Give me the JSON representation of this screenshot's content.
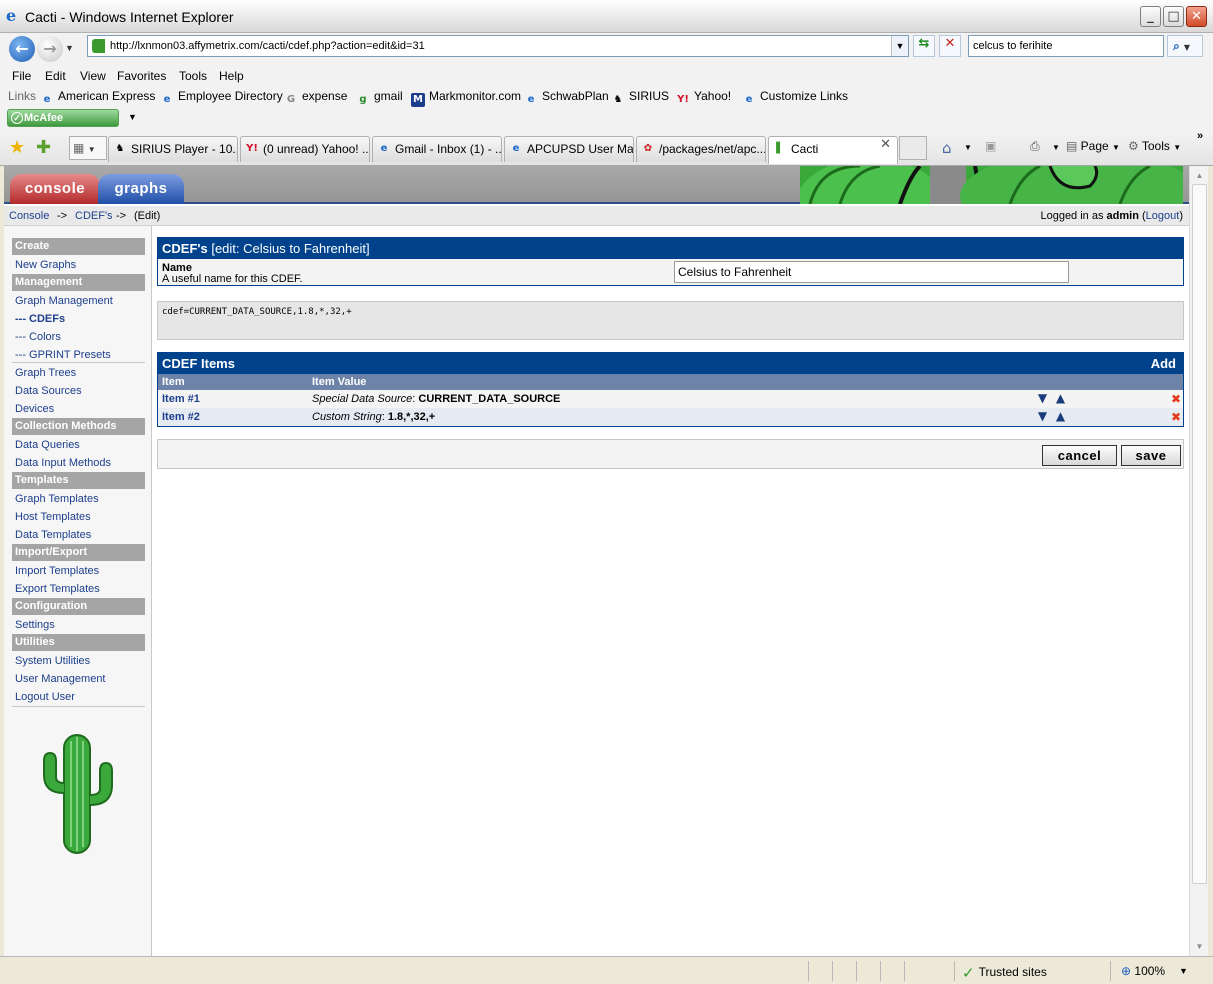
{
  "window": {
    "title": "Cacti - Windows Internet Explorer"
  },
  "address": {
    "url": "http://lxnmon03.affymetrix.com/cacti/cdef.php?action=edit&id=31"
  },
  "search": {
    "value": "celcus to ferihite"
  },
  "menu": [
    "File",
    "Edit",
    "View",
    "Favorites",
    "Tools",
    "Help"
  ],
  "links": {
    "label": "Links",
    "items": [
      "American Express",
      "Employee Directory",
      "expense",
      "gmail",
      "Markmonitor.com",
      "SchwabPlan",
      "SIRIUS",
      "Yahoo!",
      "Customize Links"
    ]
  },
  "mcafee": {
    "label": "McAfee SiteAdvisor"
  },
  "tabs": [
    {
      "label": "SIRIUS Player - 10...",
      "icon": "sirius-dog-icon"
    },
    {
      "label": "(0 unread) Yahoo! ...",
      "icon": "yahoo-icon"
    },
    {
      "label": "Gmail - Inbox (1) - ...",
      "icon": "ie-page-icon"
    },
    {
      "label": "APCUPSD User Ma...",
      "icon": "ie-logo-icon"
    },
    {
      "label": "/packages/net/apc...",
      "icon": "bsd-paw-icon"
    },
    {
      "label": "Cacti",
      "icon": "cacti-icon"
    }
  ],
  "commandbar": {
    "page": "Page",
    "tools": "Tools"
  },
  "cacti": {
    "tabs": {
      "console": "console",
      "graphs": "graphs"
    },
    "breadcrumb": {
      "console": "Console",
      "sep": "->",
      "cdefs": "CDEF's",
      "edit": "(Edit)"
    },
    "login": {
      "prefix": "Logged in as",
      "user": "admin",
      "logout": "Logout"
    }
  },
  "nav": {
    "create": "Create",
    "new_graphs": "New Graphs",
    "management": "Management",
    "graph_management": "Graph Management",
    "cdefs": "--- CDEFs",
    "colors": "--- Colors",
    "gprint": "--- GPRINT Presets",
    "graph_trees": "Graph Trees",
    "data_sources": "Data Sources",
    "devices": "Devices",
    "collection_methods": "Collection Methods",
    "data_queries": "Data Queries",
    "data_input_methods": "Data Input Methods",
    "templates": "Templates",
    "graph_templates": "Graph Templates",
    "host_templates": "Host Templates",
    "data_templates": "Data Templates",
    "import_export": "Import/Export",
    "import_templates": "Import Templates",
    "export_templates": "Export Templates",
    "configuration": "Configuration",
    "settings": "Settings",
    "utilities": "Utilities",
    "system_utilities": "System Utilities",
    "user_management": "User Management",
    "logout_user": "Logout User"
  },
  "cdef": {
    "header_bold": "CDEF's",
    "header_sub": "[edit: Celsius to Fahrenheit]",
    "name_label": "Name",
    "name_desc": "A useful name for this CDEF.",
    "name_value": "Celsius to Fahrenheit",
    "string": "cdef=CURRENT_DATA_SOURCE,1.8,*,32,+",
    "items_title": "CDEF Items",
    "add": "Add",
    "col_item": "Item",
    "col_value": "Item Value",
    "items": [
      {
        "name": "Item #1",
        "type": "Special Data Source",
        "value": "CURRENT_DATA_SOURCE"
      },
      {
        "name": "Item #2",
        "type": "Custom String",
        "value": "1.8,*,32,+"
      }
    ],
    "cancel": "cancel",
    "save": "save"
  },
  "status": {
    "zone": "Trusted sites",
    "zoom": "100%"
  }
}
